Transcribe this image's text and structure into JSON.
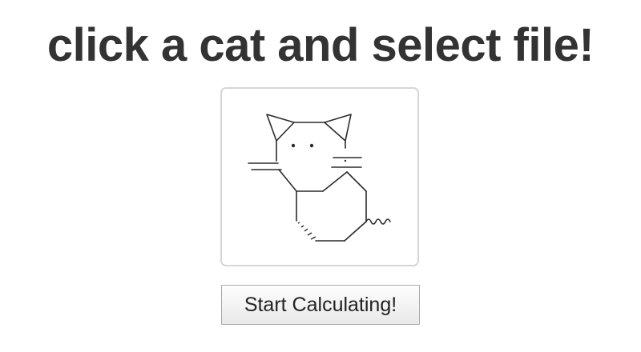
{
  "header": {
    "title": "click a cat and select file!"
  },
  "cat_picker": {
    "icon": "cat-molecule-icon"
  },
  "actions": {
    "start_label": "Start Calculating!"
  }
}
